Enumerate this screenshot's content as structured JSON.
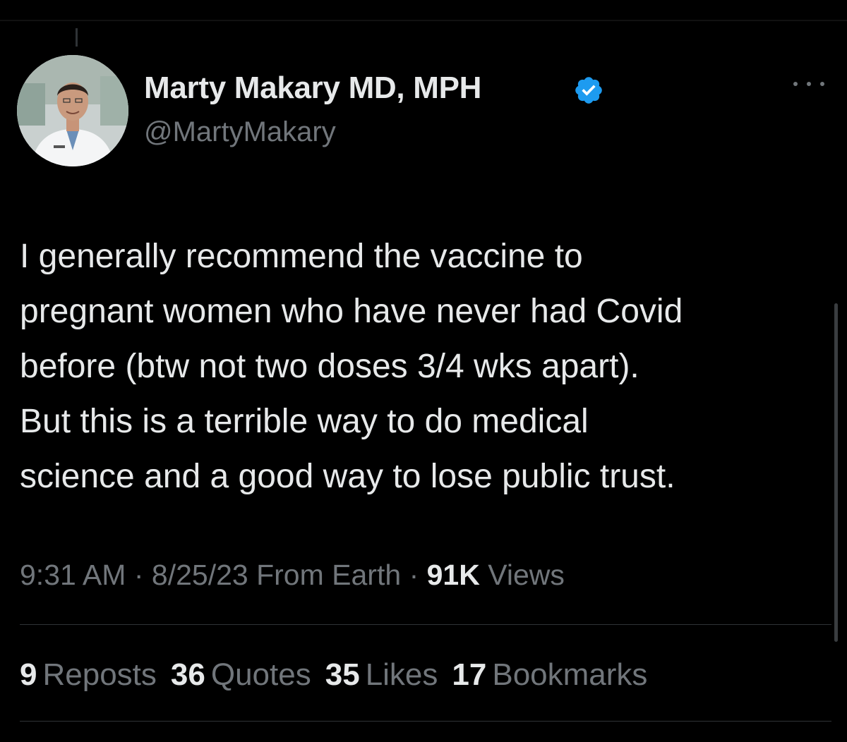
{
  "tweet": {
    "author": {
      "display_name": "Marty Makary MD, MPH",
      "handle": "@MartyMakary",
      "verified": true,
      "verified_color": "#1d9bf0"
    },
    "text": "I generally recommend the vaccine to\npregnant women who have never had Covid\nbefore (btw not two doses 3/4 wks apart).\nBut this is a terrible way to do medical\nscience and a good way to lose public trust.",
    "meta": {
      "time": "9:31 AM",
      "date": "8/25/23",
      "source": "From Earth",
      "views_count": "91K",
      "views_label": "Views",
      "separator": "·"
    },
    "stats": [
      {
        "count": "9",
        "label": "Reposts"
      },
      {
        "count": "36",
        "label": "Quotes"
      },
      {
        "count": "35",
        "label": "Likes"
      },
      {
        "count": "17",
        "label": "Bookmarks"
      }
    ],
    "icons": {
      "more": "more-horizontal-icon",
      "verified": "verified-badge-icon"
    }
  },
  "colors": {
    "background": "#000000",
    "primary_text": "#e7e9ea",
    "secondary_text": "#71767b",
    "divider": "#2f3336"
  }
}
